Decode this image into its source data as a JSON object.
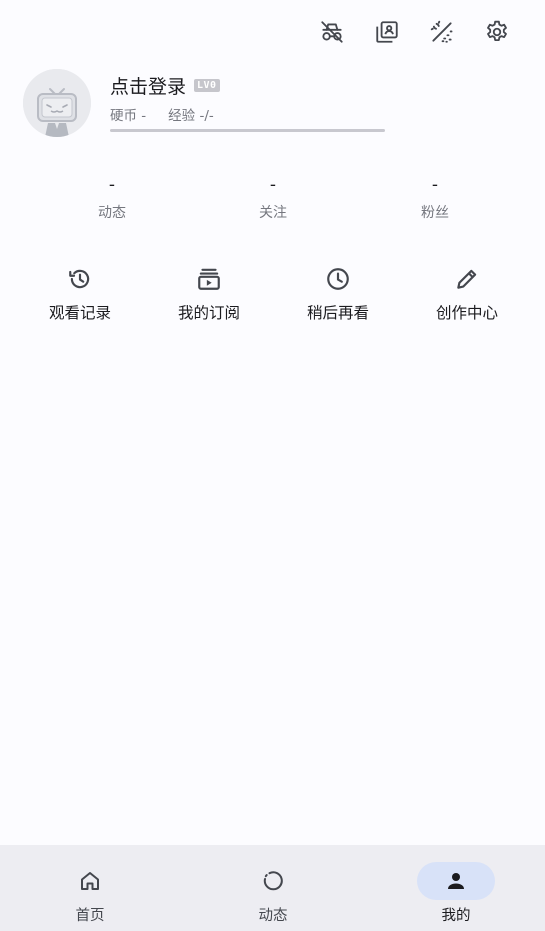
{
  "top_icons": [
    {
      "name": "incognito-icon"
    },
    {
      "name": "collection-icon"
    },
    {
      "name": "theme-icon"
    },
    {
      "name": "settings-icon"
    }
  ],
  "profile": {
    "name": "点击登录",
    "level_badge": "LV0",
    "coins_label": "硬币 -",
    "exp_label": "经验 -/-",
    "exp_progress": 0
  },
  "counts": [
    {
      "value": "-",
      "label": "动态"
    },
    {
      "value": "-",
      "label": "关注"
    },
    {
      "value": "-",
      "label": "粉丝"
    }
  ],
  "shortcuts": [
    {
      "label": "观看记录",
      "icon": "history-icon"
    },
    {
      "label": "我的订阅",
      "icon": "subscription-icon"
    },
    {
      "label": "稍后再看",
      "icon": "clock-icon"
    },
    {
      "label": "创作中心",
      "icon": "pencil-icon"
    }
  ],
  "bottom_nav": [
    {
      "label": "首页",
      "icon": "home-icon",
      "active": false
    },
    {
      "label": "动态",
      "icon": "refresh-icon",
      "active": false
    },
    {
      "label": "我的",
      "icon": "person-icon",
      "active": true
    }
  ],
  "colors": {
    "background": "#fcfcff",
    "nav_background": "#ededf2",
    "active_pill": "#d8e2f8",
    "icon": "#44474e",
    "muted_text": "#75777f"
  }
}
